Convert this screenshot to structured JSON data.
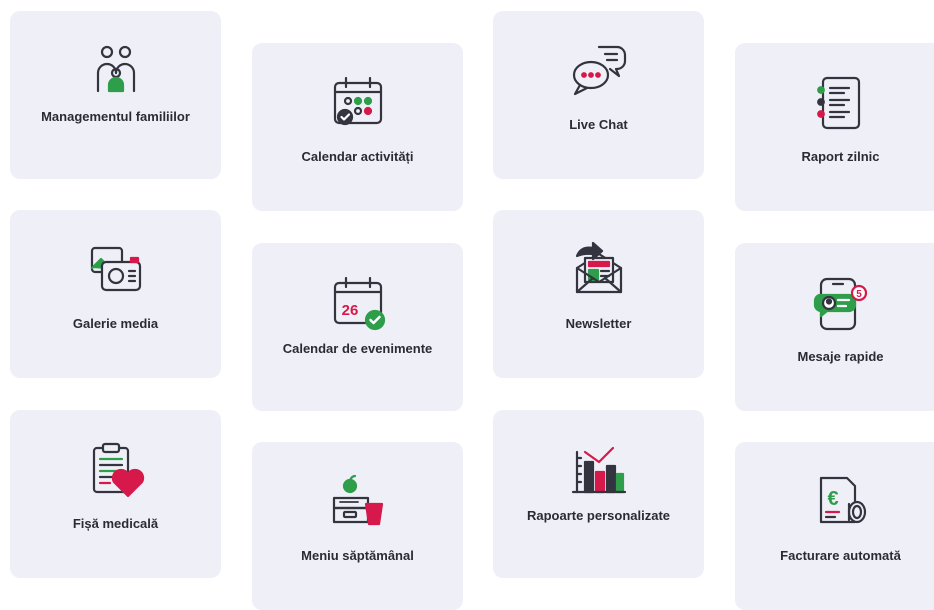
{
  "colors": {
    "card_bg": "#eff0f7",
    "outline": "#33343f",
    "accent_green": "#2e9e4a",
    "accent_red": "#d6194a",
    "text": "#2b2b33"
  },
  "features": [
    {
      "label": "Managementul familiilor",
      "icon": "family-icon"
    },
    {
      "label": "Calendar activități",
      "icon": "calendar-activities-icon"
    },
    {
      "label": "Live Chat",
      "icon": "chat-bubbles-icon"
    },
    {
      "label": "Raport zilnic",
      "icon": "daily-report-icon"
    },
    {
      "label": "Galerie media",
      "icon": "media-gallery-icon"
    },
    {
      "label": "Calendar de evenimente",
      "icon": "event-calendar-icon",
      "day": "26"
    },
    {
      "label": "Newsletter",
      "icon": "newsletter-icon"
    },
    {
      "label": "Mesaje rapide",
      "icon": "quick-messages-icon",
      "badge": "5"
    },
    {
      "label": "Fișă medicală",
      "icon": "medical-record-icon"
    },
    {
      "label": "Meniu săptămânal",
      "icon": "weekly-menu-icon"
    },
    {
      "label": "Rapoarte personalizate",
      "icon": "custom-reports-icon"
    },
    {
      "label": "Facturare automată",
      "icon": "automatic-billing-icon",
      "currency": "€"
    }
  ]
}
